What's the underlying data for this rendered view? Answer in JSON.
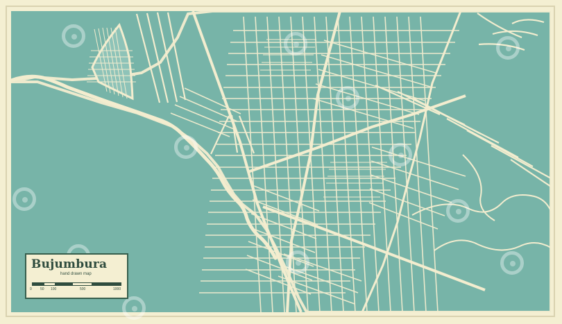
{
  "legend": {
    "title": "Bujumbura",
    "subtitle": "hand drawn map",
    "scale_labels": [
      "0",
      "50",
      "100",
      "500",
      "1000"
    ]
  },
  "map": {
    "colors": {
      "water": "#77b4a8",
      "land": "#77b4a8",
      "road": "#f3edcf",
      "frame": "#f4efd2",
      "legend_border": "#365e4d",
      "text": "#2f4c3e"
    }
  },
  "watermark_icons": [
    "stock-logo-icon"
  ]
}
